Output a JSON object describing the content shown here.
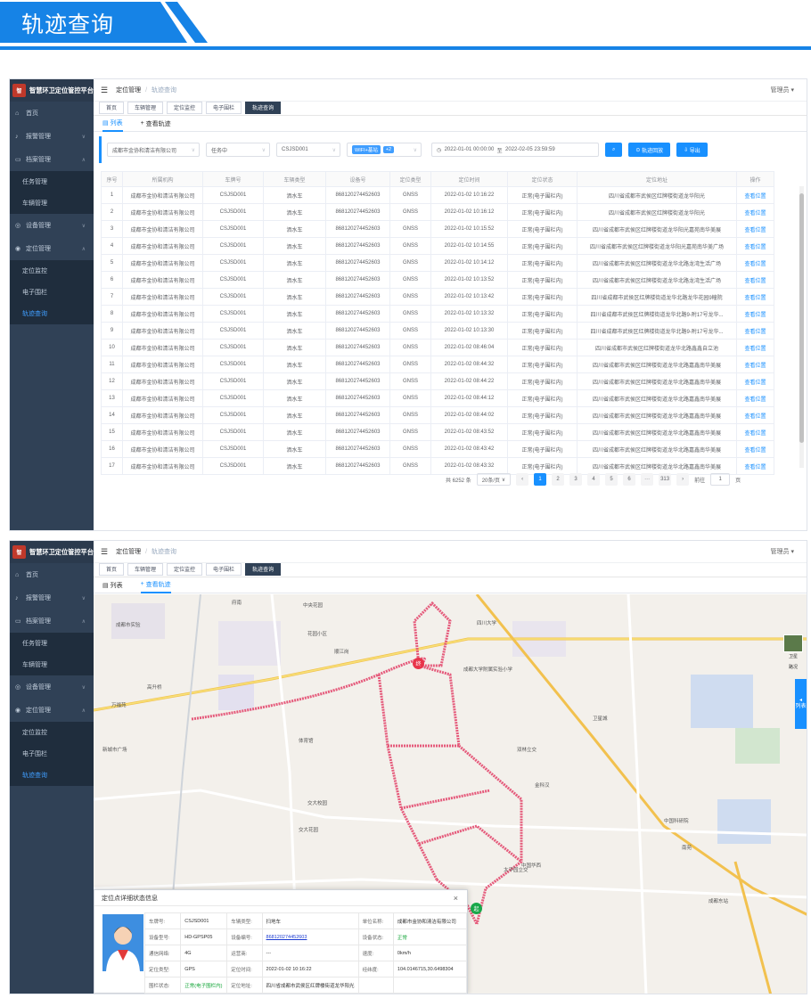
{
  "header": {
    "title": "轨迹查询"
  },
  "app": {
    "logo_mark": "智",
    "logo_text": "智慧环卫定位管控平台",
    "menu": [
      {
        "label": "首页",
        "icon": "home-icon"
      },
      {
        "label": "报警管理",
        "icon": "bell-icon"
      },
      {
        "label": "档案管理",
        "icon": "folder-icon"
      }
    ],
    "archive_sub": [
      "任务管理",
      "车辆管理"
    ],
    "menu2": [
      {
        "label": "设备管理",
        "icon": "device-icon"
      },
      {
        "label": "定位管理",
        "icon": "location-icon"
      }
    ],
    "loc_sub": [
      "定位监控",
      "电子围栏",
      "轨迹查询"
    ],
    "breadcrumb": {
      "parent": "定位管理",
      "current": "轨迹查询"
    },
    "user": "管理员",
    "tabs": [
      "首页",
      "车辆管理",
      "定位监控",
      "电子围栏",
      "轨迹查询"
    ],
    "subtabs": {
      "list": "列表",
      "track": "查看轨迹"
    }
  },
  "filters": {
    "org": "成都市金协和清洁有限公司",
    "task": "任务中",
    "plate": "CSJSD001",
    "tag": "WIFI+基站",
    "tag_more": "+2",
    "date_start": "2022-01-01 00:00:00",
    "date_to": "至",
    "date_end": "2022-02-05 23:59:59",
    "btn_playback": "轨迹回放",
    "btn_export": "导出"
  },
  "table": {
    "headers": [
      "序号",
      "所属机构",
      "车牌号",
      "车辆类型",
      "设备号",
      "定位类型",
      "定位时间",
      "定位状态",
      "定位地址",
      "操作"
    ],
    "rows": [
      [
        "1",
        "成都市金协和清洁有限公司",
        "CSJSD001",
        "洒水车",
        "868120274452603",
        "GNSS",
        "2022-01-02 10:16:22",
        "正常(电子围栏内)",
        "四川省成都市武侯区红牌楼街道龙华阳光",
        "查看位置"
      ],
      [
        "2",
        "成都市金协和清洁有限公司",
        "CSJSD001",
        "洒水车",
        "868120274452603",
        "GNSS",
        "2022-01-02 10:16:12",
        "正常(电子围栏内)",
        "四川省成都市武侯区红牌楼街道龙华阳光",
        "查看位置"
      ],
      [
        "3",
        "成都市金协和清洁有限公司",
        "CSJSD001",
        "洒水车",
        "868120274452603",
        "GNSS",
        "2022-01-02 10:15:52",
        "正常(电子围栏内)",
        "四川省成都市武侯区红牌楼街道龙华阳光嘉苑南华美展",
        "查看位置"
      ],
      [
        "4",
        "成都市金协和清洁有限公司",
        "CSJSD001",
        "洒水车",
        "868120274452603",
        "GNSS",
        "2022-01-02 10:14:55",
        "正常(电子围栏内)",
        "四川省成都市武侯区红牌楼街道龙华阳光嘉苑南华美广场",
        "查看位置"
      ],
      [
        "5",
        "成都市金协和清洁有限公司",
        "CSJSD001",
        "洒水车",
        "868120274452603",
        "GNSS",
        "2022-01-02 10:14:12",
        "正常(电子围栏内)",
        "四川省成都市武侯区红牌楼街道龙华北路龙湾生活广场",
        "查看位置"
      ],
      [
        "6",
        "成都市金协和清洁有限公司",
        "CSJSD001",
        "洒水车",
        "868120274452603",
        "GNSS",
        "2022-01-02 10:13:52",
        "正常(电子围栏内)",
        "四川省成都市武侯区红牌楼街道龙华北路龙湾生活广场",
        "查看位置"
      ],
      [
        "7",
        "成都市金协和清洁有限公司",
        "CSJSD001",
        "洒水车",
        "868120274452603",
        "GNSS",
        "2022-01-02 10:13:42",
        "正常(电子围栏内)",
        "四川省成都市武侯区红牌楼街道龙华北路龙华花园9幢院",
        "查看位置"
      ],
      [
        "8",
        "成都市金协和清洁有限公司",
        "CSJSD001",
        "洒水车",
        "868120274452603",
        "GNSS",
        "2022-01-02 10:13:32",
        "正常(电子围栏内)",
        "四川省成都市武侯区红牌楼街道龙华北路9-附17号龙华...",
        "查看位置"
      ],
      [
        "9",
        "成都市金协和清洁有限公司",
        "CSJSD001",
        "洒水车",
        "868120274452603",
        "GNSS",
        "2022-01-02 10:13:30",
        "正常(电子围栏内)",
        "四川省成都市武侯区红牌楼街道龙华北路9-附17号龙华...",
        "查看位置"
      ],
      [
        "10",
        "成都市金协和清洁有限公司",
        "CSJSD001",
        "洒水车",
        "868120274452603",
        "GNSS",
        "2022-01-02 08:46:04",
        "正常(电子围栏内)",
        "四川省成都市武侯区红牌楼街道龙华北路鑫鑫自立池",
        "查看位置"
      ],
      [
        "11",
        "成都市金协和清洁有限公司",
        "CSJSD001",
        "洒水车",
        "868120274452603",
        "GNSS",
        "2022-01-02 08:44:32",
        "正常(电子围栏内)",
        "四川省成都市武侯区红牌楼街道龙华北路嘉鑫南华美展",
        "查看位置"
      ],
      [
        "12",
        "成都市金协和清洁有限公司",
        "CSJSD001",
        "洒水车",
        "868120274452603",
        "GNSS",
        "2022-01-02 08:44:22",
        "正常(电子围栏内)",
        "四川省成都市武侯区红牌楼街道龙华北路嘉鑫南华美展",
        "查看位置"
      ],
      [
        "13",
        "成都市金协和清洁有限公司",
        "CSJSD001",
        "洒水车",
        "868120274452603",
        "GNSS",
        "2022-01-02 08:44:12",
        "正常(电子围栏内)",
        "四川省成都市武侯区红牌楼街道龙华北路嘉鑫南华美展",
        "查看位置"
      ],
      [
        "14",
        "成都市金协和清洁有限公司",
        "CSJSD001",
        "洒水车",
        "868120274452603",
        "GNSS",
        "2022-01-02 08:44:02",
        "正常(电子围栏内)",
        "四川省成都市武侯区红牌楼街道龙华北路嘉鑫南华美展",
        "查看位置"
      ],
      [
        "15",
        "成都市金协和清洁有限公司",
        "CSJSD001",
        "洒水车",
        "868120274452603",
        "GNSS",
        "2022-01-02 08:43:52",
        "正常(电子围栏内)",
        "四川省成都市武侯区红牌楼街道龙华北路嘉鑫南华美展",
        "查看位置"
      ],
      [
        "16",
        "成都市金协和清洁有限公司",
        "CSJSD001",
        "洒水车",
        "868120274452603",
        "GNSS",
        "2022-01-02 08:43:42",
        "正常(电子围栏内)",
        "四川省成都市武侯区红牌楼街道龙华北路嘉鑫南华美展",
        "查看位置"
      ],
      [
        "17",
        "成都市金协和清洁有限公司",
        "CSJSD001",
        "洒水车",
        "868120274452603",
        "GNSS",
        "2022-01-02 08:43:32",
        "正常(电子围栏内)",
        "四川省成都市武侯区红牌楼街道龙华北路嘉鑫南华美展",
        "查看位置"
      ]
    ]
  },
  "pagination": {
    "total": "共 6252 条",
    "page_size": "20条/页",
    "pages": [
      "1",
      "2",
      "3",
      "4",
      "5",
      "6",
      "···",
      "313"
    ],
    "current_page": "1",
    "goto": "前往",
    "goto_value": "1",
    "page_unit": "页"
  },
  "map": {
    "labels": [
      "中央花园",
      "成都市实验",
      "花园小区",
      "双林立交",
      "成都大学附属实验小学",
      "四川大学",
      "金科汉",
      "中国华西",
      "太平园立交",
      "高升桥",
      "顺江岗",
      "交大花园",
      "体育馆",
      "卫星城",
      "万福苑",
      "府南",
      "新城市广场",
      "交大校园",
      "中国科研院",
      "成都东站",
      "南苑"
    ],
    "satellite": "卫星",
    "panorama": "路况",
    "side_list": "列表",
    "marker_start": "终",
    "marker_end": "起"
  },
  "popup": {
    "title": "定位点详细状态信息",
    "close": "×",
    "rows": [
      [
        "车牌号:",
        "CSJSD001",
        "车辆类型:",
        "扫地车",
        "单位名称:",
        "成都市金协和清洁有限公司"
      ],
      [
        "设备型号:",
        "HD-GPSP05",
        "设备编号:",
        "868120274452603",
        "设备状态:",
        "正常"
      ],
      [
        "通信网络:",
        "4G",
        "运营商:",
        "---",
        "速度:",
        "0km/h"
      ],
      [
        "定位类型:",
        "GPS",
        "定位时间:",
        "2022-01-02 10:16:22",
        "经纬度:",
        "104.0146715,30.6498304"
      ],
      [
        "围栏状态:",
        "正常(电子围栏内)",
        "定位地址:",
        "四川省成都市武侯区红牌楼街道龙华阳光",
        "",
        ""
      ]
    ]
  },
  "colors": {
    "accent": "#1683e6",
    "sidebar": "#304156",
    "track": "#e55a7b",
    "link": "#1890ff"
  }
}
